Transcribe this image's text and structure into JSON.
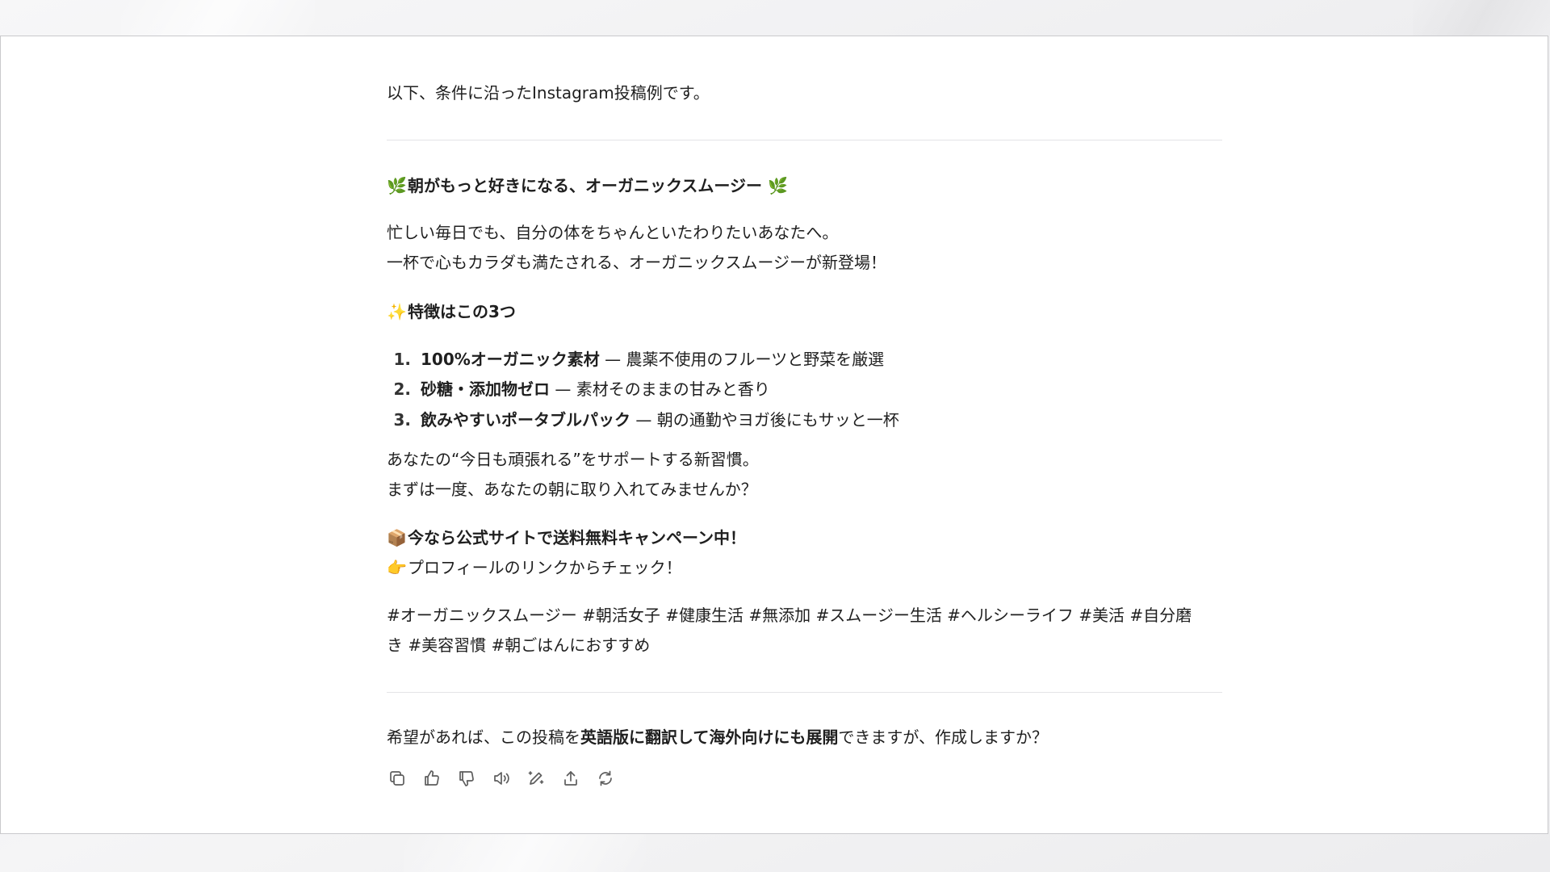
{
  "message": {
    "intro": "以下、条件に沿ったInstagram投稿例です。",
    "headline": {
      "emoji_left": "🌿",
      "text": "朝がもっと好きになる、オーガニックスムージー",
      "emoji_right": "🌿"
    },
    "body": [
      "忙しい毎日でも、自分の体をちゃんといたわりたいあなたへ。",
      "一杯で心もカラダも満たされる、オーガニックスムージーが新登場！"
    ],
    "features_heading": {
      "emoji": "✨",
      "text": "特徴はこの3つ"
    },
    "features": [
      {
        "number": "1.",
        "title": "100%オーガニック素材",
        "desc": " — 農薬不使用のフルーツと野菜を厳選"
      },
      {
        "number": "2.",
        "title": "砂糖・添加物ゼロ",
        "desc": " — 素材そのままの甘みと香り"
      },
      {
        "number": "3.",
        "title": "飲みやすいポータブルパック",
        "desc": " — 朝の通勤やヨガ後にもサッと一杯"
      }
    ],
    "closing": [
      "あなたの“今日も頑張れる”をサポートする新習慣。",
      "まずは一度、あなたの朝に取り入れてみませんか？"
    ],
    "campaign": {
      "emoji": "📦",
      "text": "今なら公式サイトで送料無料キャンペーン中！"
    },
    "cta": {
      "emoji": "👉",
      "text": "プロフィールのリンクからチェック！"
    },
    "hashtags": [
      "#オーガニックスムージー #朝活女子 #健康生活 #無添加 #スムージー生活 #ヘルシーライフ #美活 #自分磨",
      "き #美容習慣 #朝ごはんにおすすめ"
    ],
    "followup": {
      "before": "希望があれば、この投稿を",
      "bold": "英語版に翻訳して海外向けにも展開",
      "after": "できますが、作成しますか？"
    }
  },
  "actions": [
    {
      "name": "copy-icon"
    },
    {
      "name": "thumbs-up-icon"
    },
    {
      "name": "thumbs-down-icon"
    },
    {
      "name": "read-aloud-icon"
    },
    {
      "name": "edit-icon"
    },
    {
      "name": "share-icon"
    },
    {
      "name": "regenerate-icon"
    }
  ],
  "colors": {
    "text": "#1f1f1f",
    "icon": "#5d5d5d",
    "divider": "#e4e4e7",
    "frame_border": "#c9c9cc"
  }
}
